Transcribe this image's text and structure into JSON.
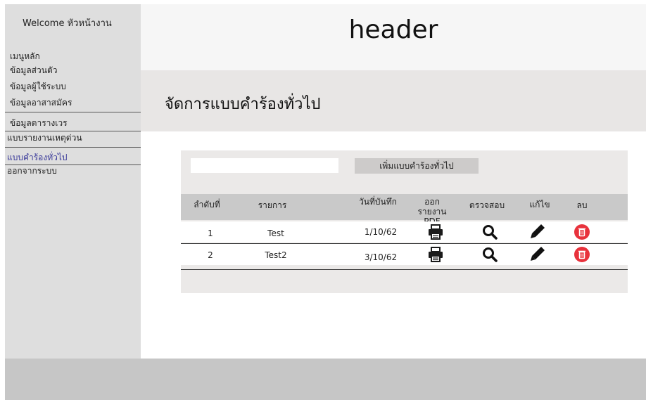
{
  "sidebar": {
    "welcome": "Welcome หัวหน้างาน",
    "items": [
      {
        "label": "เมนูหลัก"
      },
      {
        "label": "ข้อมูลส่วนตัว"
      },
      {
        "label": "ข้อมูลผู้ใช้ระบบ"
      },
      {
        "label": "ข้อมูลอาสาสมัคร"
      },
      {
        "label": "ข้อมูลตารางเวร"
      },
      {
        "label": "แบบรายงานเหตุด่วน"
      },
      {
        "label": "แบบคำร้องทั่วไป"
      },
      {
        "label": "ออกจากระบบ"
      }
    ]
  },
  "header": {
    "title": "header"
  },
  "page": {
    "title": "จัดการแบบคำร้องทั่วไป"
  },
  "toolbar": {
    "search_value": "",
    "add_label": "เพิ่มแบบคำร้องทั่วไป"
  },
  "table": {
    "columns": {
      "order": "ลำดับที่",
      "item": "รายการ",
      "date": "วันที่บันทึก",
      "report": "ออกรายงาน PDF",
      "inspect": "ตรวจสอบ",
      "edit": "แก้ไข",
      "delete": "ลบ"
    },
    "rows": [
      {
        "order": "1",
        "item": "Test",
        "date": "1/10/62"
      },
      {
        "order": "2",
        "item": "Test2",
        "date": "3/10/62"
      }
    ]
  },
  "colors": {
    "sidebar_bg": "#dedede",
    "delete_red": "#e8323c",
    "active_menu": "#3a3a9a"
  },
  "icons": {
    "report": "printer-icon",
    "inspect": "magnifier-icon",
    "edit": "pencil-icon",
    "delete": "trash-icon"
  }
}
